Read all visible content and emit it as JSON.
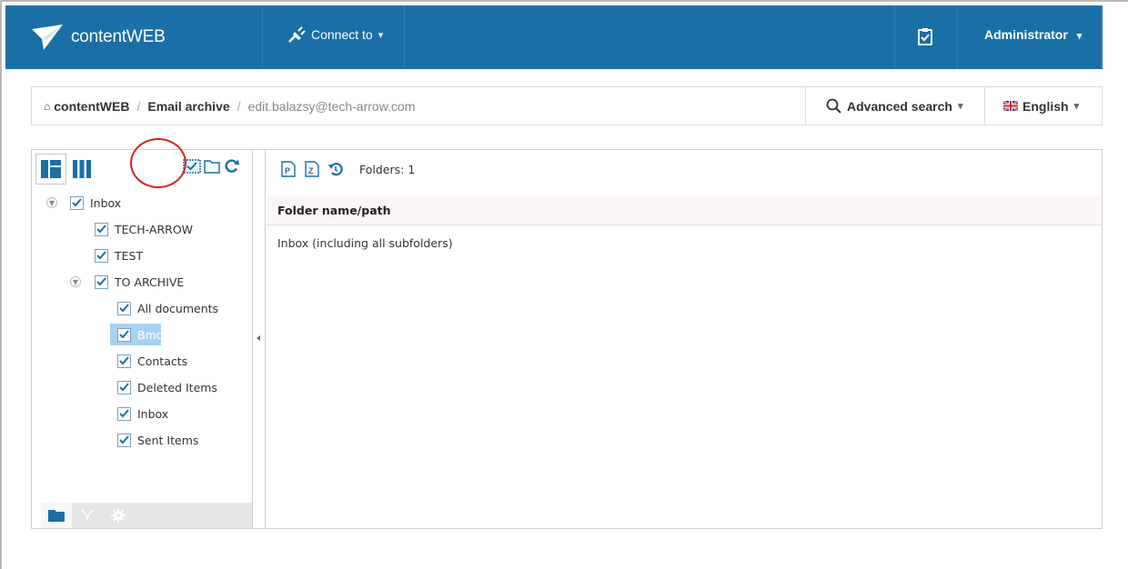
{
  "header": {
    "brand_name": "contentWEB",
    "connect_label": "Connect to",
    "connect_caret": "▾",
    "user_label": "Administrator",
    "user_caret": "▾",
    "accent_color": "#1a6fa6"
  },
  "breadcrumb": {
    "home_icon": "⌂",
    "items": [
      "contentWEB",
      "Email archive"
    ],
    "separator": "/",
    "current": "edit.balazsy@tech-arrow.com"
  },
  "search": {
    "label": "Advanced search",
    "caret": "▾"
  },
  "language": {
    "label": "English",
    "caret": "▾",
    "flag_icon": "uk-flag-icon"
  },
  "tree": {
    "nodes": [
      {
        "label": "Inbox",
        "checked": true,
        "expandable": true
      },
      {
        "label": "TECH-ARROW",
        "checked": true
      },
      {
        "label": "TEST",
        "checked": true
      },
      {
        "label": "TO ARCHIVE",
        "checked": true,
        "expandable": true
      },
      {
        "label": "All documents",
        "checked": true
      },
      {
        "label": "Bmc",
        "checked": true,
        "selected": true
      },
      {
        "label": "Contacts",
        "checked": true
      },
      {
        "label": "Deleted Items",
        "checked": true
      },
      {
        "label": "Inbox",
        "checked": true
      },
      {
        "label": "Sent Items",
        "checked": true
      }
    ],
    "selection_color": "#a9d2f0"
  },
  "results": {
    "count_text": "Folders: 1",
    "column_header": "Folder name/path",
    "rows": [
      "Inbox (including all subfolders)"
    ]
  },
  "annotation_color": "#e02020"
}
